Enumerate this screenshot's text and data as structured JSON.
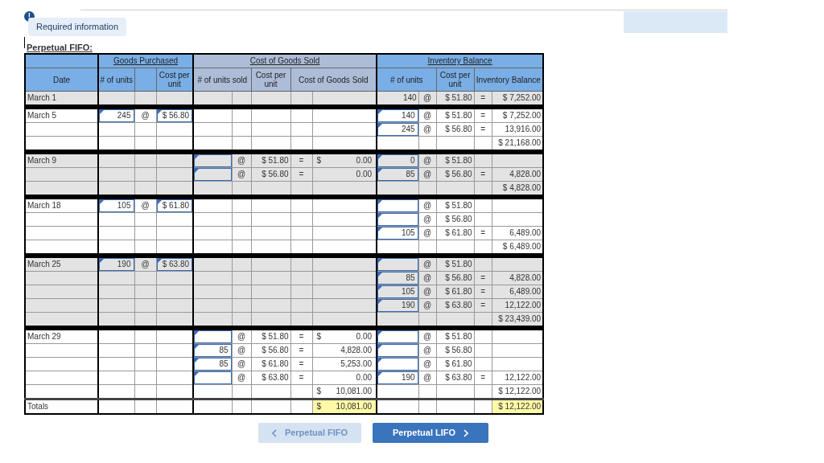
{
  "notice": {
    "label": "Required information",
    "icon": "!"
  },
  "section_title": "Perpetual FIFO:",
  "header": {
    "groups": [
      "Goods Purchased",
      "Cost of Goods Sold",
      "Inventory Balance"
    ],
    "columns": [
      "Date",
      "# of units",
      "Cost per unit",
      "# of units sold",
      "Cost per unit",
      "Cost of Goods Sold",
      "# of units",
      "Cost per unit",
      "Inventory Balance"
    ]
  },
  "groups": [
    {
      "shaded": true,
      "rows": [
        {
          "kind": "entry",
          "cells": {
            "date": {
              "kind": "text",
              "value": "March 1"
            },
            "b_units": {
              "kind": "text",
              "value": "140"
            },
            "b_at": {
              "kind": "text",
              "value": "@"
            },
            "b_cost": {
              "kind": "text",
              "value": "$ 51.80"
            },
            "b_eq": {
              "kind": "text",
              "value": "="
            },
            "b_total": {
              "kind": "text",
              "value": "$ 7,252.00"
            }
          }
        }
      ]
    },
    {
      "shaded": false,
      "rows": [
        {
          "kind": "entry",
          "cells": {
            "date": {
              "kind": "text",
              "value": "March 5"
            },
            "p_units": {
              "kind": "input",
              "value": "245"
            },
            "p_at": {
              "kind": "text",
              "value": "@"
            },
            "p_cost": {
              "kind": "input",
              "value": "$ 56.80"
            },
            "b_units": {
              "kind": "input",
              "value": "140"
            },
            "b_at": {
              "kind": "text",
              "value": "@"
            },
            "b_cost": {
              "kind": "text",
              "value": "$ 51.80"
            },
            "b_eq": {
              "kind": "text",
              "value": "="
            },
            "b_total": {
              "kind": "text",
              "value": "$ 7,252.00"
            }
          }
        },
        {
          "kind": "entry",
          "cells": {
            "b_units": {
              "kind": "input",
              "value": "245"
            },
            "b_at": {
              "kind": "text",
              "value": "@"
            },
            "b_cost": {
              "kind": "text",
              "value": "$ 56.80"
            },
            "b_eq": {
              "kind": "text",
              "value": "="
            },
            "b_total": {
              "kind": "text",
              "value": "13,916.00"
            }
          }
        },
        {
          "kind": "entry",
          "cells": {
            "b_total": {
              "kind": "text",
              "value": "$ 21,168.00"
            }
          }
        }
      ]
    },
    {
      "shaded": true,
      "rows": [
        {
          "kind": "entry",
          "cells": {
            "date": {
              "kind": "text",
              "value": "March 9"
            },
            "s_units": {
              "kind": "input"
            },
            "s_at": {
              "kind": "text",
              "value": "@"
            },
            "s_cost": {
              "kind": "text",
              "value": "$ 51.80"
            },
            "s_eq": {
              "kind": "text",
              "value": "="
            },
            "s_total": {
              "kind": "amount",
              "currency": "$",
              "value": "0.00"
            },
            "b_units": {
              "kind": "input",
              "value": "0"
            },
            "b_at": {
              "kind": "text",
              "value": "@"
            },
            "b_cost": {
              "kind": "text",
              "value": "$ 51.80"
            }
          }
        },
        {
          "kind": "entry",
          "cells": {
            "s_units": {
              "kind": "input"
            },
            "s_at": {
              "kind": "text",
              "value": "@"
            },
            "s_cost": {
              "kind": "text",
              "value": "$ 56.80"
            },
            "s_eq": {
              "kind": "text",
              "value": "="
            },
            "s_total": {
              "kind": "amount",
              "value": "0.00"
            },
            "b_units": {
              "kind": "input",
              "value": "85"
            },
            "b_at": {
              "kind": "text",
              "value": "@"
            },
            "b_cost": {
              "kind": "text",
              "value": "$ 56.80"
            },
            "b_eq": {
              "kind": "text",
              "value": "="
            },
            "b_total": {
              "kind": "text",
              "value": "4,828.00"
            }
          }
        },
        {
          "kind": "entry",
          "cells": {
            "b_total": {
              "kind": "text",
              "value": "$ 4,828.00"
            }
          }
        }
      ]
    },
    {
      "shaded": false,
      "rows": [
        {
          "kind": "entry",
          "cells": {
            "date": {
              "kind": "text",
              "value": "March 18"
            },
            "p_units": {
              "kind": "input",
              "value": "105"
            },
            "p_at": {
              "kind": "text",
              "value": "@"
            },
            "p_cost": {
              "kind": "input",
              "value": "$ 61.80"
            },
            "b_units": {
              "kind": "input"
            },
            "b_at": {
              "kind": "text",
              "value": "@"
            },
            "b_cost": {
              "kind": "text",
              "value": "$ 51.80"
            }
          }
        },
        {
          "kind": "entry",
          "cells": {
            "b_units": {
              "kind": "input"
            },
            "b_at": {
              "kind": "text",
              "value": "@"
            },
            "b_cost": {
              "kind": "text",
              "value": "$ 56.80"
            }
          }
        },
        {
          "kind": "entry",
          "cells": {
            "b_units": {
              "kind": "input",
              "value": "105"
            },
            "b_at": {
              "kind": "text",
              "value": "@"
            },
            "b_cost": {
              "kind": "text",
              "value": "$ 61.80"
            },
            "b_eq": {
              "kind": "text",
              "value": "="
            },
            "b_total": {
              "kind": "text",
              "value": "6,489.00"
            }
          }
        },
        {
          "kind": "entry",
          "cells": {
            "b_total": {
              "kind": "text",
              "value": "$ 6,489.00"
            }
          }
        }
      ]
    },
    {
      "shaded": true,
      "rows": [
        {
          "kind": "entry",
          "cells": {
            "date": {
              "kind": "text",
              "value": "March 25"
            },
            "p_units": {
              "kind": "input",
              "value": "190"
            },
            "p_at": {
              "kind": "text",
              "value": "@"
            },
            "p_cost": {
              "kind": "input",
              "value": "$ 63.80"
            },
            "b_units": {
              "kind": "input"
            },
            "b_at": {
              "kind": "text",
              "value": "@"
            },
            "b_cost": {
              "kind": "text",
              "value": "$ 51.80"
            }
          }
        },
        {
          "kind": "entry",
          "cells": {
            "b_units": {
              "kind": "input",
              "value": "85"
            },
            "b_at": {
              "kind": "text",
              "value": "@"
            },
            "b_cost": {
              "kind": "text",
              "value": "$ 56.80"
            },
            "b_eq": {
              "kind": "text",
              "value": "="
            },
            "b_total": {
              "kind": "text",
              "value": "4,828.00"
            }
          }
        },
        {
          "kind": "entry",
          "cells": {
            "b_units": {
              "kind": "input",
              "value": "105"
            },
            "b_at": {
              "kind": "text",
              "value": "@"
            },
            "b_cost": {
              "kind": "text",
              "value": "$ 61.80"
            },
            "b_eq": {
              "kind": "text",
              "value": "="
            },
            "b_total": {
              "kind": "text",
              "value": "6,489.00"
            }
          }
        },
        {
          "kind": "entry",
          "cells": {
            "b_units": {
              "kind": "input",
              "value": "190"
            },
            "b_at": {
              "kind": "text",
              "value": "@"
            },
            "b_cost": {
              "kind": "text",
              "value": "$ 63.80"
            },
            "b_eq": {
              "kind": "text",
              "value": "="
            },
            "b_total": {
              "kind": "text",
              "value": "12,122.00"
            }
          }
        },
        {
          "kind": "entry",
          "cells": {
            "b_total": {
              "kind": "text",
              "value": "$ 23,439.00"
            }
          }
        }
      ]
    },
    {
      "shaded": false,
      "rows": [
        {
          "kind": "entry",
          "cells": {
            "date": {
              "kind": "text",
              "value": "March 29"
            },
            "s_units": {
              "kind": "input"
            },
            "s_at": {
              "kind": "text",
              "value": "@"
            },
            "s_cost": {
              "kind": "text",
              "value": "$ 51.80"
            },
            "s_eq": {
              "kind": "text",
              "value": "="
            },
            "s_total": {
              "kind": "amount",
              "currency": "$",
              "value": "0.00"
            },
            "b_units": {
              "kind": "input"
            },
            "b_at": {
              "kind": "text",
              "value": "@"
            },
            "b_cost": {
              "kind": "text",
              "value": "$ 51.80"
            }
          }
        },
        {
          "kind": "entry",
          "cells": {
            "s_units": {
              "kind": "input",
              "value": "85"
            },
            "s_at": {
              "kind": "text",
              "value": "@"
            },
            "s_cost": {
              "kind": "text",
              "value": "$ 56.80"
            },
            "s_eq": {
              "kind": "text",
              "value": "="
            },
            "s_total": {
              "kind": "amount",
              "value": "4,828.00"
            },
            "b_units": {
              "kind": "input"
            },
            "b_at": {
              "kind": "text",
              "value": "@"
            },
            "b_cost": {
              "kind": "text",
              "value": "$ 56.80"
            }
          }
        },
        {
          "kind": "entry",
          "cells": {
            "s_units": {
              "kind": "input",
              "value": "85"
            },
            "s_at": {
              "kind": "text",
              "value": "@"
            },
            "s_cost": {
              "kind": "text",
              "value": "$ 61.80"
            },
            "s_eq": {
              "kind": "text",
              "value": "="
            },
            "s_total": {
              "kind": "amount",
              "value": "5,253.00"
            },
            "b_units": {
              "kind": "input"
            },
            "b_at": {
              "kind": "text",
              "value": "@"
            },
            "b_cost": {
              "kind": "text",
              "value": "$ 61.80"
            }
          }
        },
        {
          "kind": "entry",
          "cells": {
            "s_units": {
              "kind": "input"
            },
            "s_at": {
              "kind": "text",
              "value": "@"
            },
            "s_cost": {
              "kind": "text",
              "value": "$ 63.80"
            },
            "s_eq": {
              "kind": "text",
              "value": "="
            },
            "s_total": {
              "kind": "amount",
              "value": "0.00"
            },
            "b_units": {
              "kind": "input",
              "value": "190"
            },
            "b_at": {
              "kind": "text",
              "value": "@"
            },
            "b_cost": {
              "kind": "text",
              "value": "$ 63.80"
            },
            "b_eq": {
              "kind": "text",
              "value": "="
            },
            "b_total": {
              "kind": "text",
              "value": "12,122.00"
            }
          }
        },
        {
          "kind": "entry",
          "cells": {
            "s_total": {
              "kind": "amount",
              "currency": "$",
              "value": "10,081.00"
            },
            "b_total": {
              "kind": "text",
              "value": "$ 12,122.00"
            }
          }
        }
      ]
    },
    {
      "shaded": false,
      "rows": [
        {
          "kind": "totals",
          "cells": {
            "date": {
              "kind": "text",
              "value": "Totals"
            },
            "s_total": {
              "kind": "amount",
              "currency": "$",
              "value": "10,081.00"
            },
            "b_total": {
              "kind": "text",
              "value": "$ 12,122.00"
            }
          }
        }
      ]
    }
  ],
  "buttons": [
    {
      "label": "Perpetual FIFO",
      "kind": "prev",
      "disabled": true
    },
    {
      "label": "Perpetual LIFO",
      "kind": "next",
      "disabled": false
    }
  ]
}
